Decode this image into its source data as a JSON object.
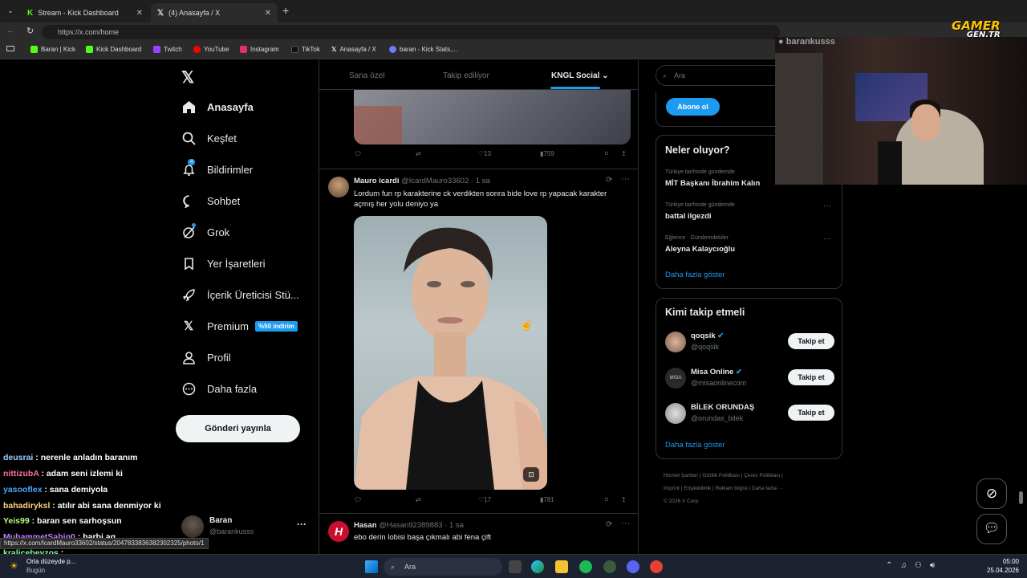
{
  "browser": {
    "tabs": [
      {
        "label": "Stream - Kick Dashboard",
        "icon": "kick-icon"
      },
      {
        "label": "(4) Anasayfa / X",
        "icon": "x-icon"
      }
    ],
    "url": "https://x.com/home",
    "bookmarks": [
      "Baran | Kick",
      "Kick Dashboard",
      "Twitch",
      "YouTube",
      "Instagram",
      "TikTok",
      "Anasayfa / X",
      "baran - Kick Stats,..."
    ],
    "status_url": "https://x.com/IcardMauro33602/status/2047833836382302325/photo/1"
  },
  "sidebar": {
    "items": [
      {
        "label": "Anasayfa",
        "icon": "home-icon"
      },
      {
        "label": "Keşfet",
        "icon": "search-icon"
      },
      {
        "label": "Bildirimler",
        "icon": "bell-icon",
        "badge": "4"
      },
      {
        "label": "Sohbet",
        "icon": "chat-icon"
      },
      {
        "label": "Grok",
        "icon": "grok-icon"
      },
      {
        "label": "Yer İşaretleri",
        "icon": "bookmark-icon"
      },
      {
        "label": "İçerik Üreticisi Stü...",
        "icon": "rocket-icon"
      },
      {
        "label": "Premium",
        "icon": "x-premium-icon",
        "badge": "%50 indirim"
      },
      {
        "label": "Profil",
        "icon": "profile-icon"
      },
      {
        "label": "Daha fazla",
        "icon": "more-icon"
      }
    ],
    "post_button": "Gönderi yayınla",
    "account": {
      "name": "Baran",
      "handle": "@barankusss"
    }
  },
  "feed": {
    "tabs": [
      "Sana özel",
      "Takip ediliyor",
      "KNGL Social"
    ],
    "post0": {
      "likes": "13",
      "views": "759"
    },
    "post1": {
      "name": "Mauro icardi",
      "handle": "@IcardMauro33602",
      "time": "· 1 sa",
      "text": "Lordum fun rp karakterine ck verdikten sonra bide love rp yapacak karakter açmış her yolu deniyo ya",
      "likes": "17",
      "views": "781"
    },
    "post2": {
      "name": "Hasan",
      "handle": "@Hasan92389883",
      "time": "· 1 sa",
      "text": "ebo derin lobisi başa çıkmalı abi fena çift"
    }
  },
  "right": {
    "search_placeholder": "Ara",
    "subscribe": "Abone ol",
    "trends_title": "Neler oluyor?",
    "trends": [
      {
        "context": "Türkiye tarihinde gündemde",
        "title": "MİT Başkanı İbrahim Kalın"
      },
      {
        "context": "Türkiye tarihinde gündemde",
        "title": "battal ilgezdi"
      },
      {
        "context": "Eğlence · Gündemdekiler",
        "title": "Aleyna Kalaycıoğlu"
      }
    ],
    "show_more": "Daha fazla göster",
    "who_title": "Kimi takip etmeli",
    "who": [
      {
        "name": "qoqsik",
        "handle": "@qoqsik",
        "follow": "Takip et"
      },
      {
        "name": "Misa Online",
        "handle": "@misaonlinecom",
        "follow": "Takip et"
      },
      {
        "name": "BİLEK ORUNDAŞ",
        "handle": "@orundas_bilek",
        "follow": "Takip et"
      }
    ],
    "footer": [
      "Hizmet Şartları",
      "Gizlilik Politikası",
      "Çerez Politikası",
      "Imprint",
      "Erişilebilirlik",
      "Reklam bilgisi",
      "Daha fazla ···",
      "© 2026 X Corp."
    ]
  },
  "overlay": {
    "streamer_name": "barankusss",
    "logo_line1": "GAMER",
    "logo_line2": "GEN.TR"
  },
  "chat": [
    {
      "user": "deusrai",
      "msg": " : nerenle anladın baranım",
      "color": "#9ad0ff"
    },
    {
      "user": "nittizubA",
      "msg": " : adam seni izlemi ki",
      "color": "#ff6fa8"
    },
    {
      "user": "yasooflex",
      "msg": " : sana demiyola",
      "color": "#4aa8ff"
    },
    {
      "user": "bahadiryksl",
      "msg": " : atılır abi sana denmiyor ki",
      "color": "#ffd27a"
    },
    {
      "user": "Yeis99",
      "msg": " : baran sen sarhoşsun",
      "color": "#b7ff7a"
    },
    {
      "user": "MuhammetSahin0",
      "msg": " : harbi aq",
      "color": "#c77dff"
    },
    {
      "user": "kralicebeyzos",
      "msg": " : ",
      "color": "#7dff9b"
    }
  ],
  "taskbar": {
    "weather": "Orta düzeyde p...",
    "weather_sub": "Bugün",
    "search": "Ara",
    "time": "05:00",
    "date": "25.04.2026"
  }
}
